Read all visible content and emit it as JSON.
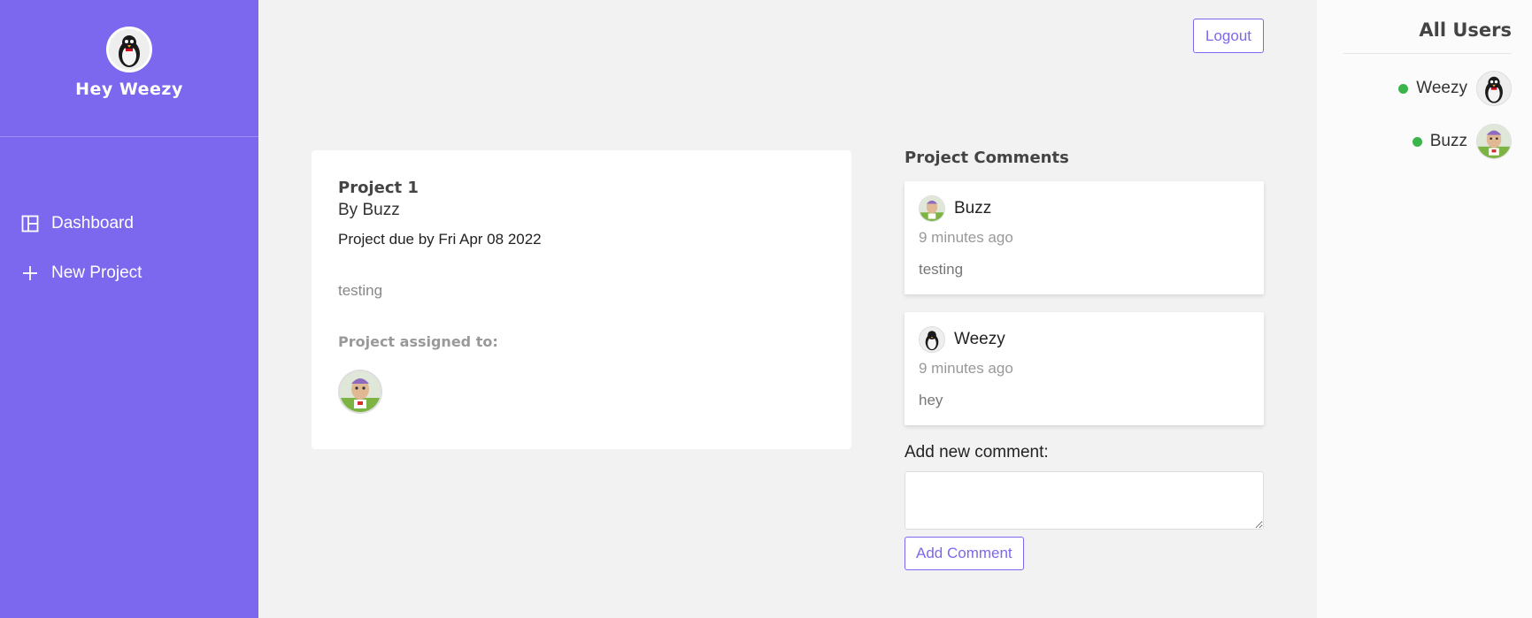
{
  "sidebar": {
    "greeting": "Hey Weezy",
    "avatar_icon": "penguin-avatar",
    "nav": [
      {
        "label": "Dashboard",
        "icon": "dashboard-icon"
      },
      {
        "label": "New Project",
        "icon": "plus-icon"
      }
    ],
    "color": "#7b68ee"
  },
  "header": {
    "logout_label": "Logout"
  },
  "project": {
    "title": "Project 1",
    "author": "By Buzz",
    "due": "Project due by Fri Apr 08 2022",
    "description": "testing",
    "assigned_label": "Project assigned to:",
    "assigned_avatar_icon": "buzz-avatar"
  },
  "comments": {
    "title": "Project Comments",
    "items": [
      {
        "author": "Buzz",
        "time": "9 minutes ago",
        "text": "testing",
        "avatar_icon": "buzz-avatar"
      },
      {
        "author": "Weezy",
        "time": "9 minutes ago",
        "text": "hey",
        "avatar_icon": "penguin-avatar"
      }
    ],
    "add_label": "Add new comment:",
    "input_value": "",
    "add_button_label": "Add Comment"
  },
  "users": {
    "title": "All Users",
    "items": [
      {
        "name": "Weezy",
        "online": true,
        "avatar_icon": "penguin-avatar"
      },
      {
        "name": "Buzz",
        "online": true,
        "avatar_icon": "buzz-avatar"
      }
    ],
    "online_color": "#3bb54a"
  }
}
